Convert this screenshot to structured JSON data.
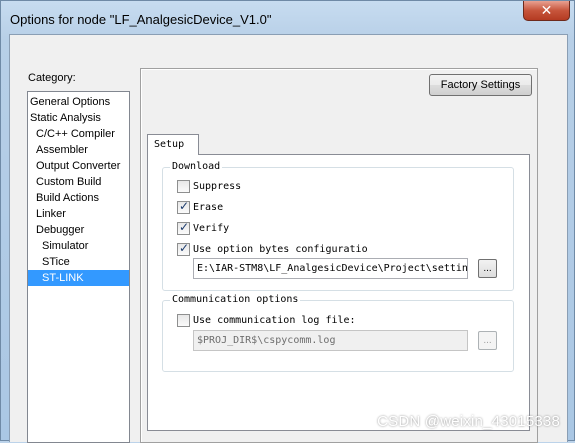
{
  "window": {
    "title": "Options for node \"LF_AnalgesicDevice_V1.0\"",
    "close_label": "✕"
  },
  "category": {
    "label": "Category:",
    "items": [
      {
        "label": "General Options",
        "indent": 0,
        "selected": false
      },
      {
        "label": "Static Analysis",
        "indent": 0,
        "selected": false
      },
      {
        "label": "C/C++ Compiler",
        "indent": 1,
        "selected": false
      },
      {
        "label": "Assembler",
        "indent": 1,
        "selected": false
      },
      {
        "label": "Output Converter",
        "indent": 1,
        "selected": false
      },
      {
        "label": "Custom Build",
        "indent": 1,
        "selected": false
      },
      {
        "label": "Build Actions",
        "indent": 1,
        "selected": false
      },
      {
        "label": "Linker",
        "indent": 1,
        "selected": false
      },
      {
        "label": "Debugger",
        "indent": 1,
        "selected": false
      },
      {
        "label": "Simulator",
        "indent": 2,
        "selected": false
      },
      {
        "label": "STice",
        "indent": 2,
        "selected": false
      },
      {
        "label": "ST-LINK",
        "indent": 2,
        "selected": true
      }
    ]
  },
  "panel": {
    "factory_settings_label": "Factory Settings",
    "tab_label": "Setup",
    "download": {
      "title": "Download",
      "suppress_label": "Suppress",
      "suppress_checked": false,
      "erase_label": "Erase",
      "erase_checked": true,
      "verify_label": "Verify",
      "verify_checked": true,
      "option_bytes_label": "Use option bytes configuratio",
      "option_bytes_checked": true,
      "option_bytes_path": "E:\\IAR-STM8\\LF_AnalgesicDevice\\Project\\settin",
      "browse_label": "..."
    },
    "communication": {
      "title": "Communication options",
      "log_label": "Use communication log file:",
      "log_checked": false,
      "log_path": "$PROJ_DIR$\\cspycomm.log",
      "browse_label": "..."
    }
  },
  "watermark": "CSDN @weixin_43015338"
}
